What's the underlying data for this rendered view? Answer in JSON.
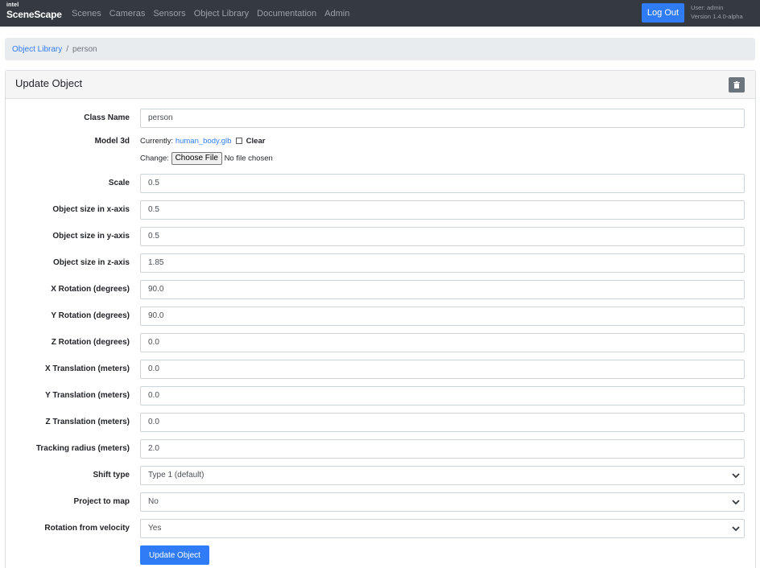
{
  "navbar": {
    "brand_small": "intel",
    "brand_name": "SceneScape",
    "links": [
      "Scenes",
      "Cameras",
      "Sensors",
      "Object Library",
      "Documentation",
      "Admin"
    ],
    "logout_label": "Log Out",
    "user_line": "User: admin",
    "version_line": "Version 1.4.0-alpha"
  },
  "breadcrumb": {
    "parent": "Object Library",
    "separator": "/",
    "current": "person"
  },
  "card": {
    "title": "Update Object",
    "delete_icon": "trash-icon"
  },
  "form": {
    "class_name": {
      "label": "Class Name",
      "value": "person"
    },
    "model_3d": {
      "label": "Model 3d",
      "currently_prefix": "Currently:",
      "file_link": "human_body.glb",
      "clear_label": "Clear",
      "change_prefix": "Change:",
      "choose_button": "Choose File",
      "no_file_text": "No file chosen"
    },
    "scale": {
      "label": "Scale",
      "value": "0.5"
    },
    "size_x": {
      "label": "Object size in x-axis",
      "value": "0.5"
    },
    "size_y": {
      "label": "Object size in y-axis",
      "value": "0.5"
    },
    "size_z": {
      "label": "Object size in z-axis",
      "value": "1.85"
    },
    "rot_x": {
      "label": "X Rotation (degrees)",
      "value": "90.0"
    },
    "rot_y": {
      "label": "Y Rotation (degrees)",
      "value": "90.0"
    },
    "rot_z": {
      "label": "Z Rotation (degrees)",
      "value": "0.0"
    },
    "trans_x": {
      "label": "X Translation (meters)",
      "value": "0.0"
    },
    "trans_y": {
      "label": "Y Translation (meters)",
      "value": "0.0"
    },
    "trans_z": {
      "label": "Z Translation (meters)",
      "value": "0.0"
    },
    "tracking_radius": {
      "label": "Tracking radius (meters)",
      "value": "2.0"
    },
    "shift_type": {
      "label": "Shift type",
      "value": "Type 1 (default)"
    },
    "project_to_map": {
      "label": "Project to map",
      "value": "No"
    },
    "rotation_from_velocity": {
      "label": "Rotation from velocity",
      "value": "Yes"
    },
    "submit_label": "Update Object"
  },
  "colors": {
    "navbar_bg": "#343a40",
    "primary": "#2f7cf6",
    "breadcrumb_bg": "#e9ecef",
    "delete_bg": "#6c757d"
  }
}
